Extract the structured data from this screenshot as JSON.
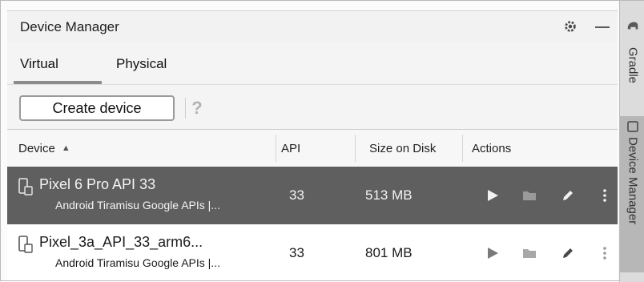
{
  "panel": {
    "title": "Device Manager"
  },
  "tabs": [
    {
      "label": "Virtual",
      "selected": true
    },
    {
      "label": "Physical",
      "selected": false
    }
  ],
  "toolbar": {
    "create_label": "Create device",
    "help_glyph": "?"
  },
  "table": {
    "columns": [
      {
        "label": "Device",
        "sort": "ascending"
      },
      {
        "label": "API"
      },
      {
        "label": "Size on Disk"
      },
      {
        "label": "Actions"
      }
    ],
    "rows": [
      {
        "name": "Pixel 6 Pro API 33",
        "subtitle": "Android Tiramisu Google APIs |...",
        "api": "33",
        "size": "513 MB",
        "selected": true
      },
      {
        "name": "Pixel_3a_API_33_arm6...",
        "subtitle": "Android Tiramisu Google APIs |...",
        "api": "33",
        "size": "801 MB",
        "selected": false
      }
    ]
  },
  "sidebar": {
    "tabs": [
      {
        "label": "Gradle"
      },
      {
        "label": "Device Manager",
        "selected": true
      }
    ]
  },
  "icons": {
    "settings": "gear-icon",
    "minimize": "minimize-icon",
    "help": "help-icon",
    "sort": "sort-ascending-icon",
    "device": "phone-icon",
    "launch": "play-icon",
    "explore": "folder-icon",
    "edit": "pencil-icon",
    "more": "more-vertical-icon"
  },
  "colors": {
    "selected_row": "#5f5f5f",
    "tab_underline": "#8c8c8c",
    "sidebar_selected": "#b7b7b7"
  }
}
